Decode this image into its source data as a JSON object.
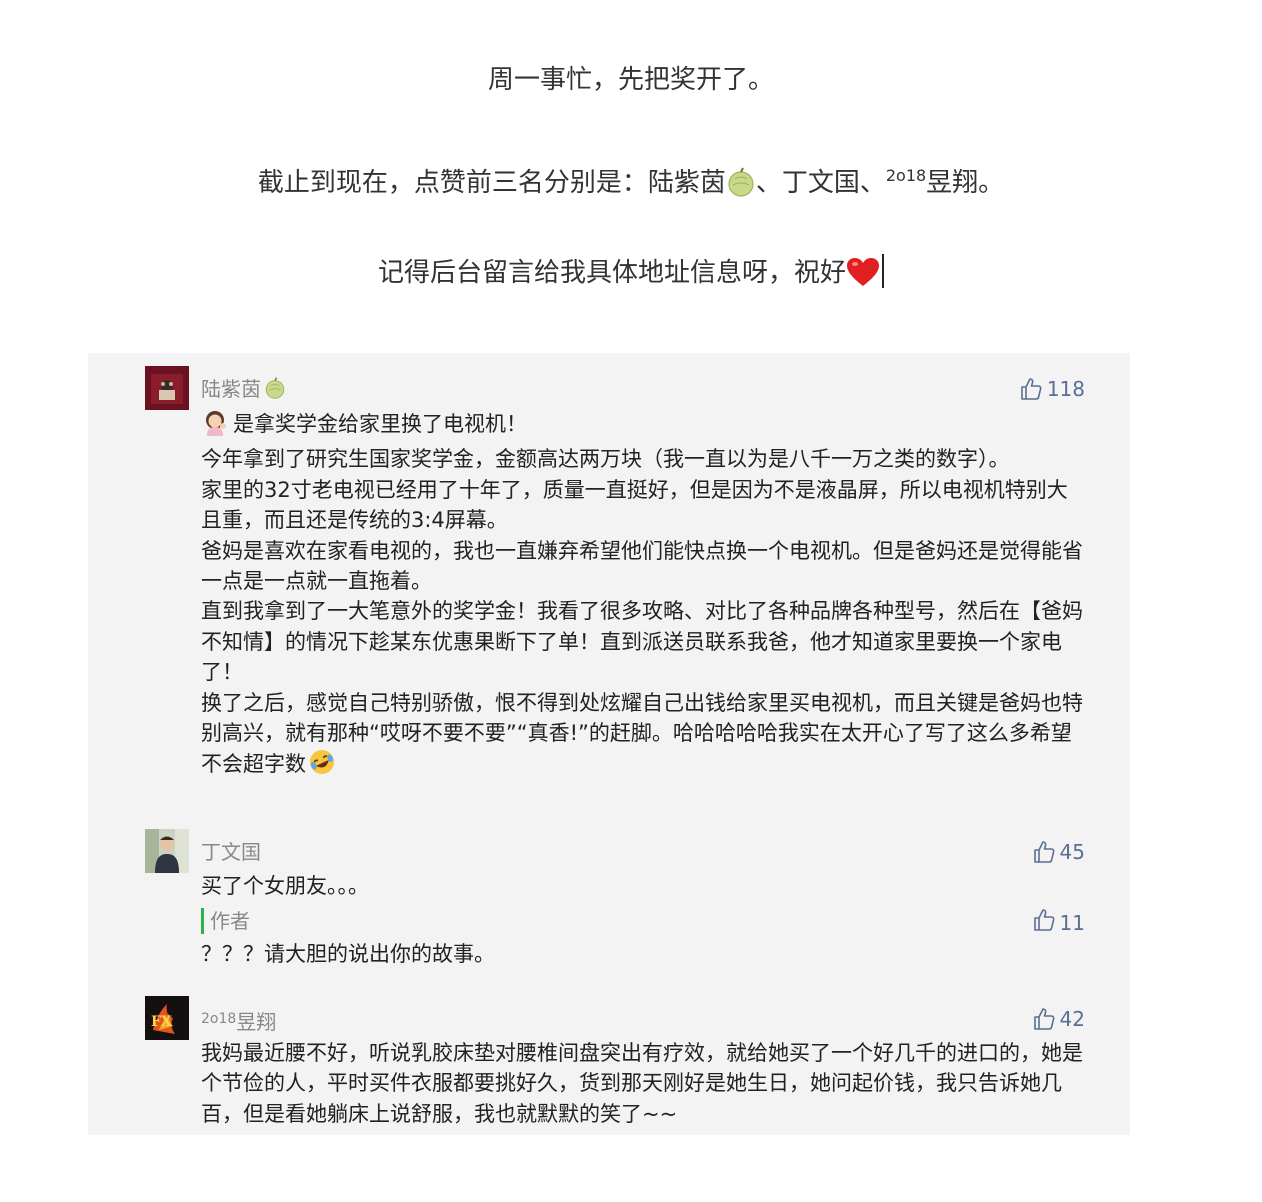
{
  "intro": {
    "line1": "周一事忙，先把奖开了。",
    "line2_prefix": "截止到现在，点赞前三名分别是：陆紫茵",
    "line2_mid": "、丁文国、",
    "line2_sup": "2o18",
    "line2_suffix": "昱翔。",
    "line3": "记得后台留言给我具体地址信息呀，祝好"
  },
  "comments": [
    {
      "name": "陆紫茵",
      "likes": "118",
      "body": [
        "是拿奖学金给家里换了电视机！",
        "今年拿到了研究生国家奖学金，金额高达两万块（我一直以为是八千一万之类的数字）。",
        "家里的32寸老电视已经用了十年了，质量一直挺好，但是因为不是液晶屏，所以电视机特别大且重，而且还是传统的3:4屏幕。",
        "爸妈是喜欢在家看电视的，我也一直嫌弃希望他们能快点换一个电视机。但是爸妈还是觉得能省一点是一点就一直拖着。",
        "直到我拿到了一大笔意外的奖学金！我看了很多攻略、对比了各种品牌各种型号，然后在【爸妈不知情】的情况下趁某东优惠果断下了单！直到派送员联系我爸，他才知道家里要换一个家电了！",
        "换了之后，感觉自己特别骄傲，恨不得到处炫耀自己出钱给家里买电视机，而且关键是爸妈也特别高兴，就有那种“哎呀不要不要”“真香!”的赶脚。哈哈哈哈哈我实在太开心了写了这么多希望不会超字数"
      ]
    },
    {
      "name": "丁文国",
      "likes": "45",
      "body": [
        "买了个女朋友。。。"
      ],
      "reply": {
        "label": "作者",
        "likes": "11",
        "body": "？？？请大胆的说出你的故事。"
      }
    },
    {
      "name_sup": "2o18",
      "name": "昱翔",
      "likes": "42",
      "body": [
        "我妈最近腰不好，听说乳胶床垫对腰椎间盘突出有疗效，就给她买了一个好几千的进口的，她是个节俭的人，平时买件衣服都要挑好久，货到那天刚好是她生日，她问起价钱，我只告诉她几百，但是看她躺床上说舒服，我也就默默的笑了~~"
      ]
    }
  ],
  "colors": {
    "panel_bg": "#f3f3f3",
    "name": "#888888",
    "likes": "#5a6f93",
    "author_bar": "#2bb24c"
  },
  "icons": [
    "like-thumb-icon",
    "melon-emoji-icon",
    "red-heart-emoji-icon",
    "woman-tipping-hand-emoji-icon",
    "laughing-crying-emoji-icon"
  ]
}
